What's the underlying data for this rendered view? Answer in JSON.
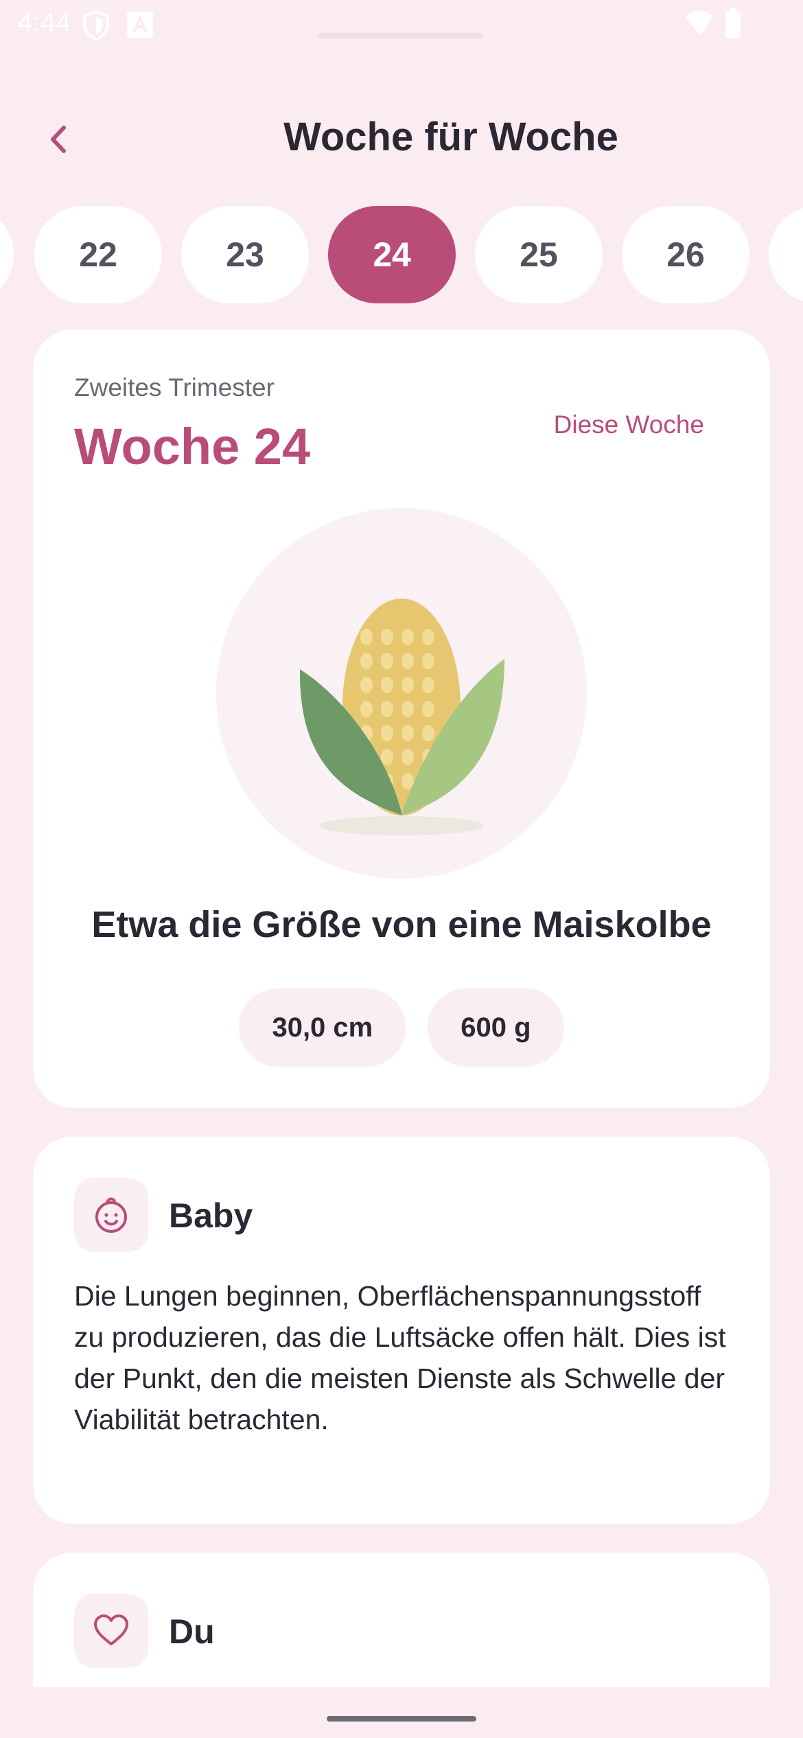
{
  "status_bar": {
    "time": "4:44",
    "icons": [
      "shield-icon",
      "text-a-icon",
      "wifi-icon",
      "battery-icon"
    ]
  },
  "header": {
    "title": "Woche für Woche",
    "back_icon": "chevron-left-icon"
  },
  "week_selector": {
    "weeks": [
      "22",
      "23",
      "24",
      "25",
      "26"
    ],
    "selected": "24"
  },
  "main_card": {
    "trimester": "Zweites Trimester",
    "week_label": "Woche 24",
    "this_week_link": "Diese Woche",
    "fruit_icon": "corn-icon",
    "size_text": "Etwa die Größe von eine Maiskolbe",
    "length": "30,0 cm",
    "weight": "600 g"
  },
  "baby_section": {
    "icon": "baby-face-icon",
    "title": "Baby",
    "body": "Die Lungen beginnen, Oberflächenspannungsstoff zu produzieren, das die Luftsäcke offen hält. Dies ist der Punkt, den die meisten Dienste als Schwelle der Viabilität betrachten."
  },
  "du_section": {
    "icon": "heart-icon",
    "title": "Du"
  },
  "colors": {
    "background": "#fbecf1",
    "accent": "#b94d78",
    "card": "#ffffff",
    "text": "#2b2834"
  }
}
